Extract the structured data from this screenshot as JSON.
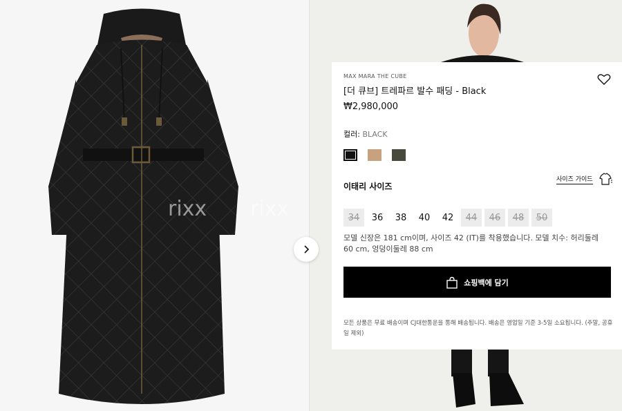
{
  "product": {
    "brand": "MAX MARA THE CUBE",
    "title": "[더 큐브] 트레파르 발수 패딩 - Black",
    "price": "₩2,980,000"
  },
  "color": {
    "label": "컬러:",
    "value": "BLACK",
    "swatches": [
      {
        "name": "black",
        "hex": "#111111"
      },
      {
        "name": "camel",
        "hex": "#c8a27f"
      },
      {
        "name": "olive",
        "hex": "#454a3c"
      }
    ]
  },
  "size": {
    "title": "이태리 사이즈",
    "guide_label": "사이즈 가이드",
    "options": [
      {
        "label": "34",
        "available": false
      },
      {
        "label": "36",
        "available": true
      },
      {
        "label": "38",
        "available": true
      },
      {
        "label": "40",
        "available": true
      },
      {
        "label": "42",
        "available": true
      },
      {
        "label": "44",
        "available": false
      },
      {
        "label": "46",
        "available": false
      },
      {
        "label": "48",
        "available": false
      },
      {
        "label": "50",
        "available": false
      }
    ]
  },
  "model_info": "모델 신장은 181 cm이며, 사이즈 42 (IT)를 착용했습니다. 모델 치수: 허리둘레 60 cm, 엉덩이둘레 88 cm",
  "cart_label": "쇼핑백에 담기",
  "shipping_note": "모든 상품은 무료 배송이며 CJ대한통운을 통해 배송됩니다. 배송은 영업일 기준 3-5일 소요됩니다. (주말, 공휴일 제외)",
  "watermarks": [
    "rixx",
    "rixx"
  ],
  "icons": {
    "next": "chevron-right-icon",
    "wishlist": "heart-icon",
    "size_guide": "hanger-icon",
    "cart": "shopping-bag-icon"
  }
}
